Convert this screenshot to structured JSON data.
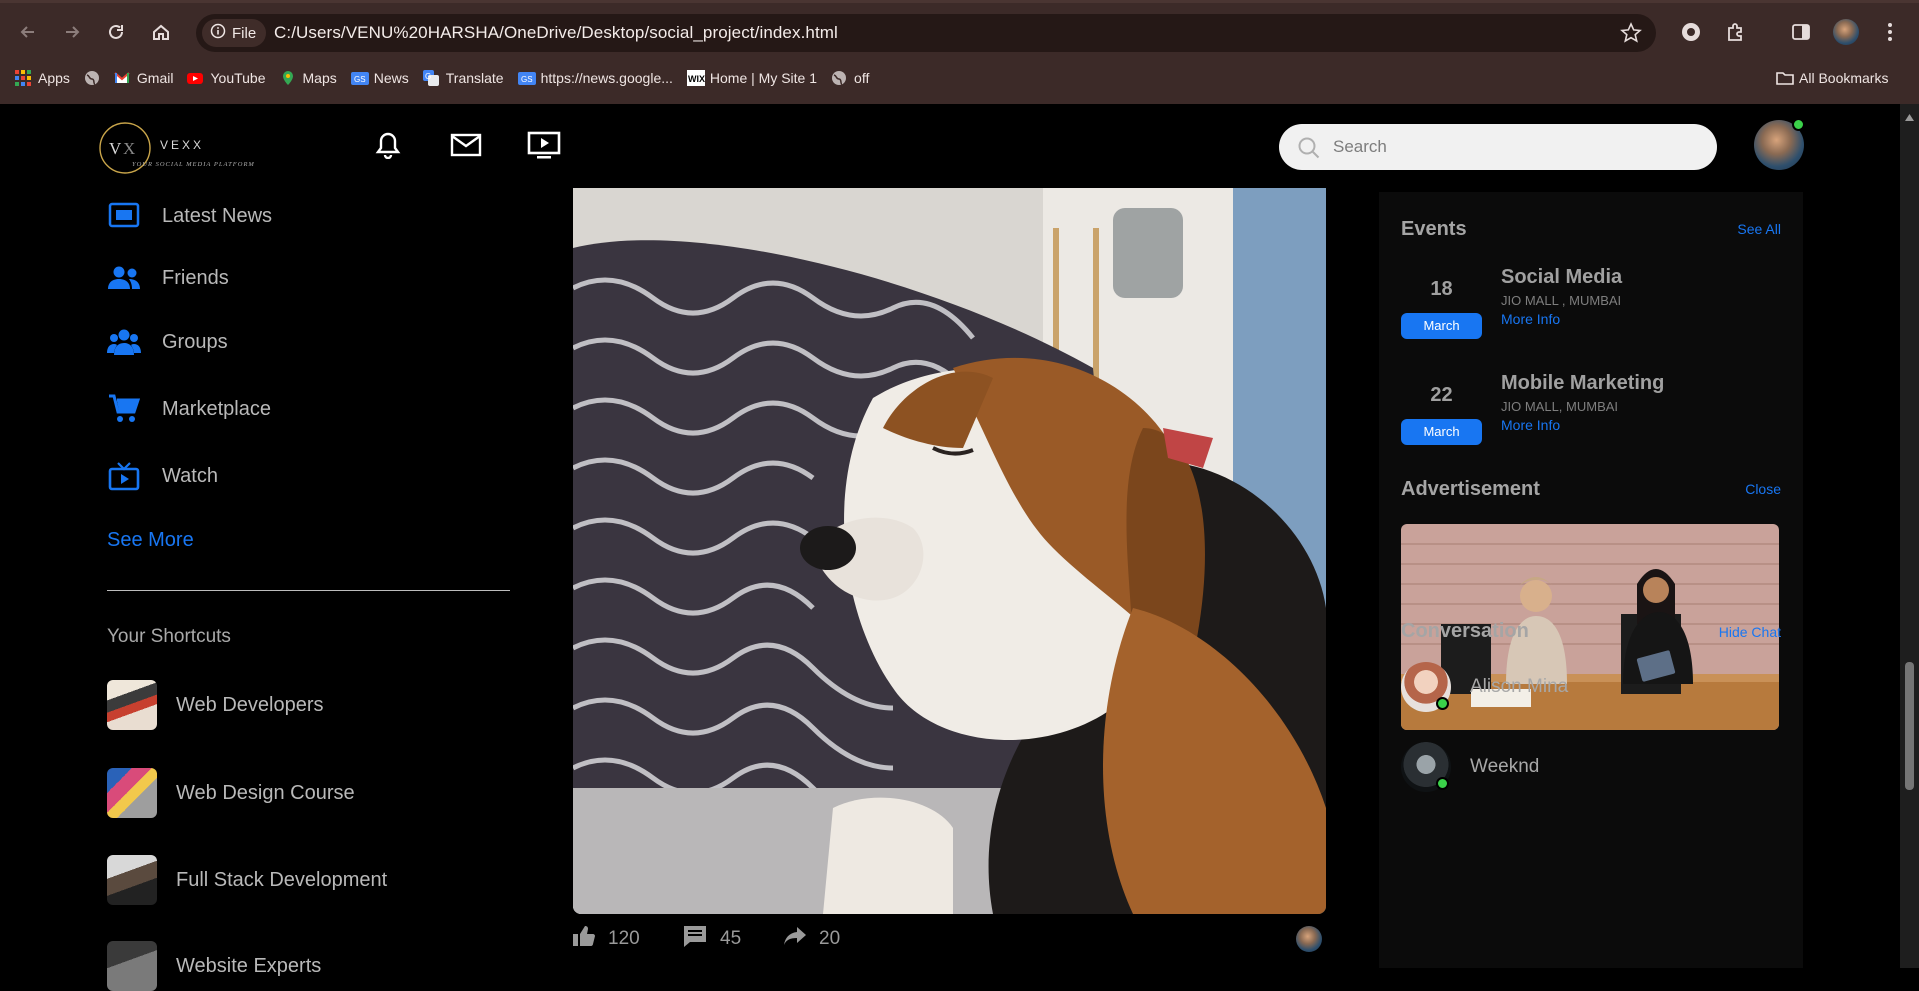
{
  "browser": {
    "file_chip": "File",
    "url": "C:/Users/VENU%20HARSHA/OneDrive/Desktop/social_project/index.html",
    "bookmarks": [
      {
        "label": "Apps",
        "icon": "apps-grid-icon"
      },
      {
        "label": "",
        "icon": "globe-icon"
      },
      {
        "label": "Gmail",
        "icon": "gmail-icon"
      },
      {
        "label": "YouTube",
        "icon": "youtube-icon"
      },
      {
        "label": "Maps",
        "icon": "maps-icon"
      },
      {
        "label": "News",
        "icon": "google-news-icon"
      },
      {
        "label": "Translate",
        "icon": "translate-icon"
      },
      {
        "label": "https://news.google...",
        "icon": "google-news-icon"
      },
      {
        "label": "Home | My Site 1",
        "icon": "wix-icon"
      },
      {
        "label": "off",
        "icon": "globe-icon"
      }
    ],
    "all_bookmarks": "All Bookmarks"
  },
  "header": {
    "logo_name": "VEXX",
    "logo_tagline": "YOUR SOCIAL MEDIA PLATFORM",
    "search_placeholder": "Search"
  },
  "left_menu": {
    "items": [
      {
        "label": "Latest News",
        "icon": "news-icon"
      },
      {
        "label": "Friends",
        "icon": "friends-icon"
      },
      {
        "label": "Groups",
        "icon": "groups-icon"
      },
      {
        "label": "Marketplace",
        "icon": "cart-icon"
      },
      {
        "label": "Watch",
        "icon": "watch-icon"
      }
    ],
    "see_more": "See More",
    "shortcuts_title": "Your Shortcuts",
    "shortcuts": [
      {
        "label": "Web Developers"
      },
      {
        "label": "Web Design Course"
      },
      {
        "label": "Full Stack Development"
      },
      {
        "label": "Website Experts"
      }
    ]
  },
  "post": {
    "likes": "120",
    "comments": "45",
    "shares": "20"
  },
  "right": {
    "events_title": "Events",
    "see_all": "See All",
    "events": [
      {
        "day": "18",
        "month": "March",
        "title": "Social Media",
        "location": "JIO MALL , MUMBAI",
        "more": "More Info"
      },
      {
        "day": "22",
        "month": "March",
        "title": "Mobile Marketing",
        "location": "JIO MALL, MUMBAI",
        "more": "More Info"
      }
    ],
    "ad_title": "Advertisement",
    "ad_close": "Close",
    "conversation_title": "Conversation",
    "hide_chat": "Hide Chat",
    "contacts": [
      {
        "name": "Alison Mina",
        "online": true
      },
      {
        "name": "Weeknd",
        "online": true
      }
    ]
  },
  "colors": {
    "accent": "#1876f2",
    "online": "#3bd14a",
    "chrome_bg": "#3c2a28"
  }
}
